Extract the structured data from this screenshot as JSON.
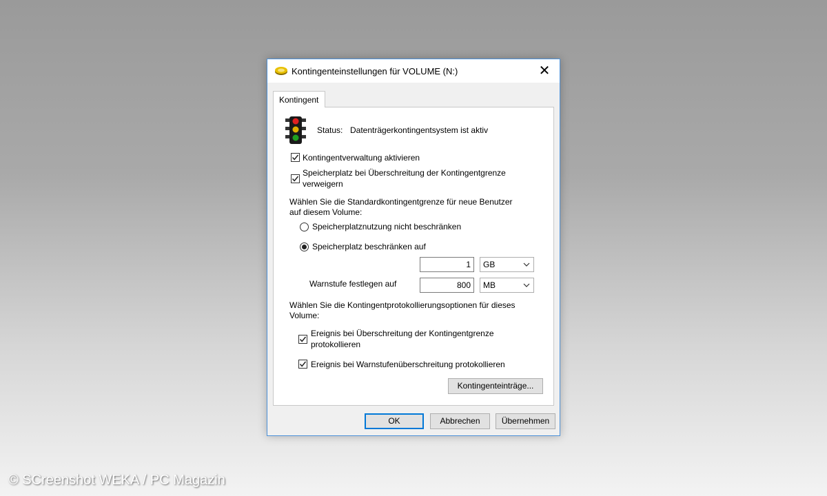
{
  "window": {
    "title": "Kontingenteinstellungen für VOLUME (N:)",
    "close_glyph": "✕"
  },
  "tab": {
    "label": "Kontingent"
  },
  "status": {
    "label": "Status:",
    "value": "Datenträgerkontingentsystem ist aktiv",
    "icon": "traffic-light-icon"
  },
  "options": {
    "enable_quota": {
      "label": "Kontingentverwaltung aktivieren",
      "checked": true
    },
    "deny_space": {
      "label_line1": "Speicherplatz bei Überschreitung der Kontingentgrenze",
      "label_line2": "verweigern",
      "checked": true
    }
  },
  "default_limit": {
    "heading_line1": "Wählen Sie die Standardkontingentgrenze für neue Benutzer",
    "heading_line2": "auf diesem Volume:",
    "no_limit_label": "Speicherplatznutzung nicht beschränken",
    "limit_label": "Speicherplatz beschränken auf",
    "selected": "limit",
    "limit_value": "1",
    "limit_unit": "GB",
    "warning_label": "Warnstufe festlegen auf",
    "warning_value": "800",
    "warning_unit": "MB"
  },
  "logging": {
    "heading_line1": "Wählen Sie die Kontingentprotokollierungsoptionen für dieses",
    "heading_line2": "Volume:",
    "log_limit": {
      "label_line1": "Ereignis bei Überschreitung der Kontingentgrenze",
      "label_line2": "protokollieren",
      "checked": true
    },
    "log_warning": {
      "label": "Ereignis bei Warnstufenüberschreitung protokollieren",
      "checked": true
    }
  },
  "buttons": {
    "entries": "Kontingenteinträge...",
    "ok": "OK",
    "cancel": "Abbrechen",
    "apply": "Übernehmen"
  },
  "watermark": "© SCreenshot WEKA / PC Magazin",
  "colors": {
    "accent": "#0078d7",
    "window_border": "#4a90d9"
  }
}
